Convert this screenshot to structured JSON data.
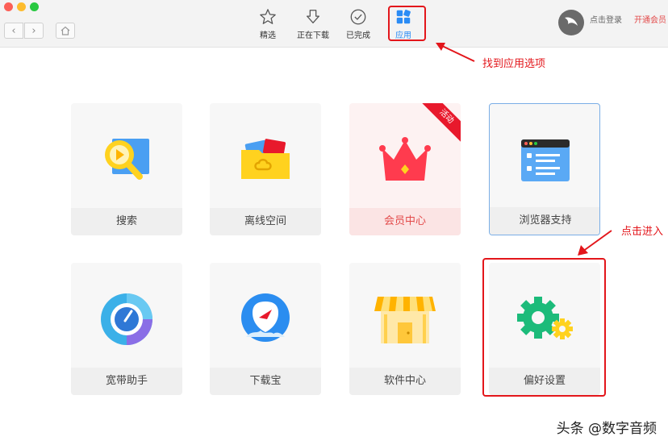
{
  "toolbar": {
    "tabs": [
      {
        "label": "精选",
        "icon": "star-icon"
      },
      {
        "label": "正在下载",
        "icon": "download-arrow-icon"
      },
      {
        "label": "已完成",
        "icon": "check-circle-icon"
      },
      {
        "label": "应用",
        "icon": "apps-grid-icon",
        "active": true
      }
    ],
    "login_label": "点击登录",
    "vip_label": "开通会员",
    "nav": {
      "back": "‹",
      "forward": "›"
    }
  },
  "annotations": {
    "find_apps": "找到应用选项",
    "click_enter": "点击进入"
  },
  "apps": [
    {
      "label": "搜索",
      "icon": "search-play-icon"
    },
    {
      "label": "离线空间",
      "icon": "offline-folder-icon"
    },
    {
      "label": "会员中心",
      "icon": "crown-icon",
      "badge": "活动"
    },
    {
      "label": "浏览器支持",
      "icon": "browser-window-icon"
    },
    {
      "label": "宽带助手",
      "icon": "speed-gauge-icon"
    },
    {
      "label": "下载宝",
      "icon": "download-bao-icon"
    },
    {
      "label": "软件中心",
      "icon": "store-icon"
    },
    {
      "label": "偏好设置",
      "icon": "gears-icon"
    }
  ],
  "watermark": "头条 @数字音频",
  "colors": {
    "accent": "#2a8cf5",
    "annotation": "#e3161b",
    "vip": "#e34b4b"
  }
}
